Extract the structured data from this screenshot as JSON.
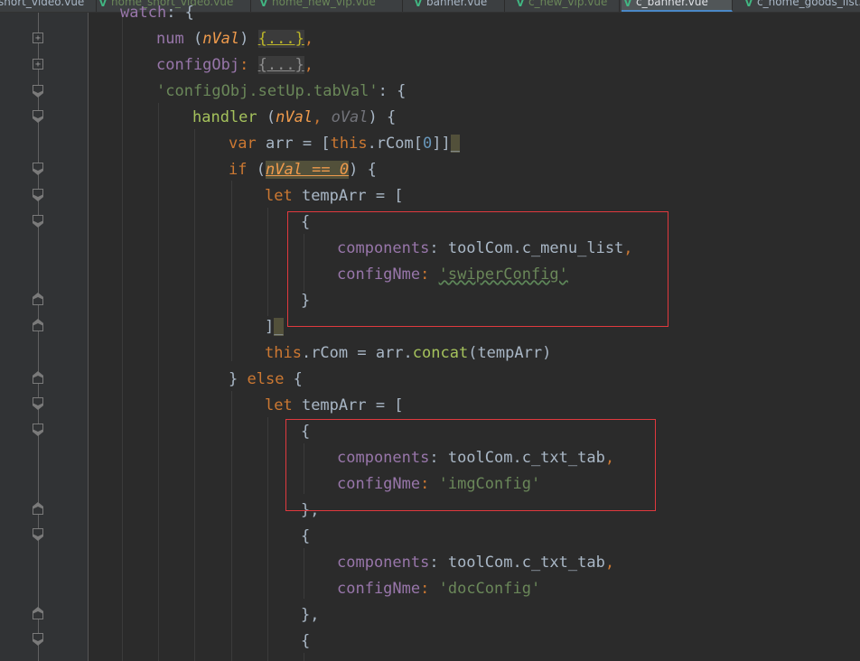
{
  "tabs": [
    {
      "label": "short_video.vue",
      "icon": "vue-icon"
    },
    {
      "label": "home_short_video.vue",
      "icon": "vue-icon"
    },
    {
      "label": "home_new_vip.vue",
      "icon": "vue-icon"
    },
    {
      "label": "banner.vue",
      "icon": "vue-icon"
    },
    {
      "label": "c_new_vip.vue",
      "icon": "vue-icon"
    },
    {
      "label": "c_banner.vue",
      "icon": "vue-icon"
    },
    {
      "label": "c_home_goods_list.vue",
      "icon": "vue-icon"
    }
  ],
  "active_tab": "c_banner.vue",
  "code": {
    "l0": {
      "t1": "watch",
      "t2": ": {"
    },
    "l1": {
      "t1": "num ",
      "t2": "(",
      "t3": "nVal",
      "t4": ") ",
      "t5": "{...}",
      "t6": ","
    },
    "l2": {
      "t1": "configObj",
      "t2": ": ",
      "t3": "{...}",
      "t4": ","
    },
    "l3": {
      "t1": "'configObj.setUp.tabVal'",
      "t2": ": {"
    },
    "l4": {
      "t1": "handler ",
      "t2": "(",
      "t3": "nVal",
      "t4": ", ",
      "t5": "oVal",
      "t6": ") {"
    },
    "l5": {
      "t1": "var ",
      "t2": "arr = [",
      "t3": "this",
      "t4": ".rCom[",
      "t5": "0",
      "t6": "]]",
      "t7": "_"
    },
    "l6": {
      "t1": "if ",
      "t2": "(",
      "t3": "nVal == 0",
      "t4": ") {"
    },
    "l7": {
      "t1": "let ",
      "t2": "tempArr = ["
    },
    "l8": {
      "t1": "{"
    },
    "l9": {
      "t1": "components",
      "t2": ": toolCom.c_menu_list",
      "t3": ","
    },
    "l10": {
      "t1": "configNme",
      "t2": ": ",
      "t3": "'swiperConfig'"
    },
    "l11": {
      "t1": "}"
    },
    "l12": {
      "t1": "]",
      "t2": "_"
    },
    "l13": {
      "t1": "this",
      "t2": ".rCom = arr.",
      "t3": "concat",
      "t4": "(tempArr)"
    },
    "l14": {
      "t1": "} ",
      "t2": "else ",
      "t3": "{"
    },
    "l15": {
      "t1": "let ",
      "t2": "tempArr = ["
    },
    "l16": {
      "t1": "{"
    },
    "l17": {
      "t1": "components",
      "t2": ": toolCom.c_txt_tab",
      "t3": ","
    },
    "l18": {
      "t1": "configNme",
      "t2": ": ",
      "t3": "'imgConfig'"
    },
    "l19": {
      "t1": "},"
    },
    "l20": {
      "t1": "{"
    },
    "l21": {
      "t1": "components",
      "t2": ": toolCom.c_txt_tab",
      "t3": ","
    },
    "l22": {
      "t1": "configNme",
      "t2": ": ",
      "t3": "'docConfig'"
    },
    "l23": {
      "t1": "},"
    },
    "l24": {
      "t1": "{"
    }
  },
  "colors": {
    "background": "#2b2b2b",
    "gutter": "#313335",
    "keyword": "#cc7832",
    "string": "#6a8759",
    "property": "#9876aa",
    "function": "#ffc66d",
    "number": "#6897bb",
    "parameter": "#ee9a4c",
    "annotation_box": "#e0393e"
  }
}
